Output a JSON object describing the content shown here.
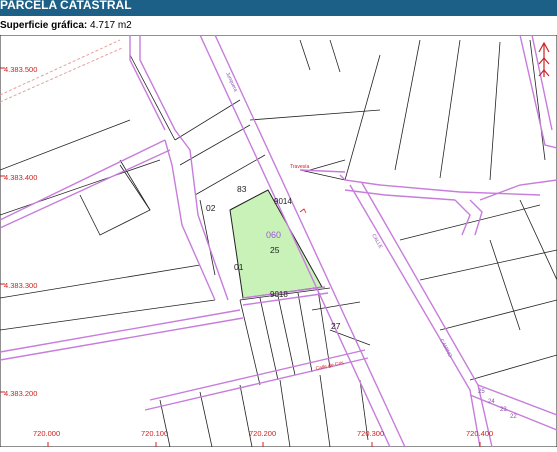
{
  "header": {
    "title": "PARCELA CATASTRAL"
  },
  "surface": {
    "label": "Superficie gráfica:",
    "value": "4.717 m2"
  },
  "map": {
    "colors": {
      "road": "#c77ddb",
      "parcel_fill": "#c8f2b8",
      "grid_label": "#cc2222",
      "line": "#222222",
      "header": "#1c5f87"
    },
    "y_labels": [
      "4.383.500",
      "4.383.400",
      "4.383.300",
      "4.383.200"
    ],
    "x_labels": [
      "720.000",
      "720.100",
      "720.200",
      "720.300",
      "720.400"
    ],
    "highlight": {
      "polygon": "060",
      "parcel": "25"
    },
    "parcel_labels": [
      "83",
      "02",
      "01",
      "9014",
      "9018",
      "27"
    ],
    "road_labels": [
      "Junquera",
      "Travesía",
      "CALLE",
      "CAMINO",
      "Calle de Cris"
    ],
    "north_arrow": "north-arrow-icon"
  }
}
